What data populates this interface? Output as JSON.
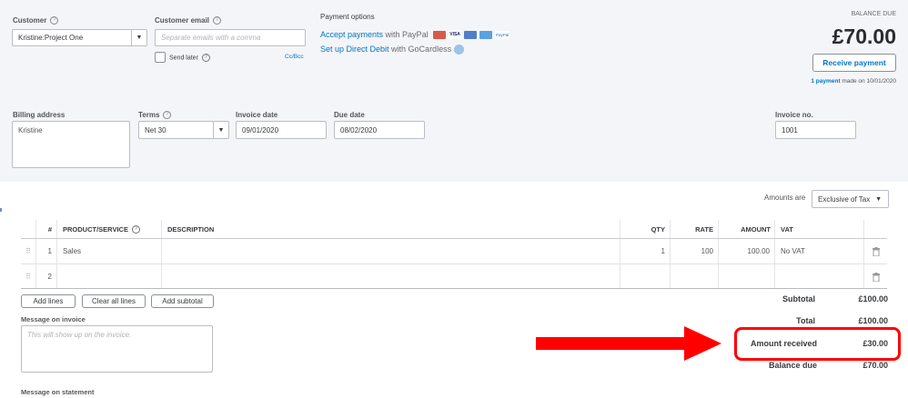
{
  "customer": {
    "label": "Customer",
    "value": "Kristine:Project One"
  },
  "email": {
    "label": "Customer email",
    "placeholder": "Separate emails with a comma",
    "send_later": "Send later",
    "cc_bcc": "Cc/Bcc"
  },
  "payment_options": {
    "title": "Payment options",
    "accept_link": "Accept payments",
    "accept_rest": " with PayPal",
    "debit_link": "Set up Direct Debit",
    "debit_rest": " with GoCardless",
    "cards": [
      "Mastercard",
      "VISA",
      "Maestro",
      "AmEx",
      "PayPal"
    ]
  },
  "balance": {
    "label": "BALANCE DUE",
    "amount": "£70.00",
    "receive_button": "Receive payment",
    "payment_link": "1 payment",
    "payment_rest": " made on 10/01/2020"
  },
  "billing": {
    "label": "Billing address",
    "value": "Kristine"
  },
  "terms": {
    "label": "Terms",
    "value": "Net 30"
  },
  "invoice_date": {
    "label": "Invoice date",
    "value": "09/01/2020"
  },
  "due_date": {
    "label": "Due date",
    "value": "08/02/2020"
  },
  "invoice_no": {
    "label": "Invoice no.",
    "value": "1001"
  },
  "amounts_are": {
    "label": "Amounts are",
    "value": "Exclusive of Tax"
  },
  "table": {
    "headers": {
      "num": "#",
      "product": "PRODUCT/SERVICE",
      "description": "DESCRIPTION",
      "qty": "QTY",
      "rate": "RATE",
      "amount": "AMOUNT",
      "vat": "VAT"
    },
    "rows": [
      {
        "num": "1",
        "product": "Sales",
        "description": "",
        "qty": "1",
        "rate": "100",
        "amount": "100.00",
        "vat": "No VAT"
      },
      {
        "num": "2",
        "product": "",
        "description": "",
        "qty": "",
        "rate": "",
        "amount": "",
        "vat": ""
      }
    ]
  },
  "buttons": {
    "add_lines": "Add lines",
    "clear_lines": "Clear all lines",
    "add_subtotal": "Add subtotal"
  },
  "message_invoice": {
    "label": "Message on invoice",
    "placeholder": "This will show up on the invoice."
  },
  "message_statement": {
    "label": "Message on statement"
  },
  "totals": {
    "subtotal": {
      "label": "Subtotal",
      "value": "£100.00"
    },
    "total": {
      "label": "Total",
      "value": "£100.00"
    },
    "amount_received": {
      "label": "Amount received",
      "value": "£30.00"
    },
    "balance_due": {
      "label": "Balance due",
      "value": "£70.00"
    }
  },
  "colors": {
    "accent": "#0077c5",
    "highlight": "#ff0000",
    "header_bg": "#f4f5f8"
  }
}
